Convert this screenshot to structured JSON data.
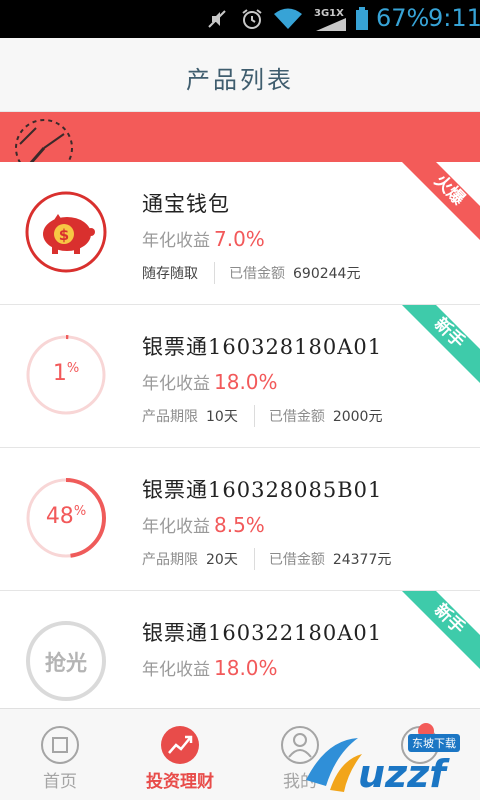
{
  "status_bar": {
    "network": "3G 1X",
    "battery": "67%",
    "time": "9:11",
    "icons": [
      "mute-icon",
      "alarm-icon",
      "wifi-icon",
      "signal-icon",
      "battery-icon"
    ]
  },
  "header": {
    "title": "产品列表"
  },
  "colors": {
    "accent": "#f35b59",
    "header_text": "#3f5d6e",
    "hot_badge": "#f35b59",
    "new_badge": "#3ecbaa"
  },
  "products": [
    {
      "name": "通宝钱包",
      "yield_label": "年化收益",
      "yield_value": "7.0%",
      "term_text": "随存随取",
      "borrowed_label": "已借金额",
      "borrowed_value": "690244元",
      "badge": "火爆",
      "icon": "piggy-bank-icon"
    },
    {
      "name": "银票通160328180A01",
      "yield_label": "年化收益",
      "yield_value": "18.0%",
      "term_label": "产品期限",
      "term_value": "10天",
      "borrowed_label": "已借金额",
      "borrowed_value": "2000元",
      "badge": "新手",
      "progress": 1,
      "progress_num": "1",
      "progress_unit": "%"
    },
    {
      "name": "银票通160328085B01",
      "yield_label": "年化收益",
      "yield_value": "8.5%",
      "term_label": "产品期限",
      "term_value": "20天",
      "borrowed_label": "已借金额",
      "borrowed_value": "24377元",
      "progress": 48,
      "progress_num": "48",
      "progress_unit": "%"
    },
    {
      "name": "银票通160322180A01",
      "yield_label": "年化收益",
      "yield_value": "18.0%",
      "badge": "新手",
      "sold_out": "抢光"
    }
  ],
  "nav": {
    "tabs": [
      {
        "label": "首页",
        "icon": "home-icon"
      },
      {
        "label": "投资理财",
        "icon": "investment-chart-icon"
      },
      {
        "label": "我的",
        "icon": "user-icon"
      },
      {
        "label": "",
        "icon": "more-icon"
      }
    ]
  },
  "watermark": {
    "text": "uzzf",
    "tag": "东坡下载"
  }
}
